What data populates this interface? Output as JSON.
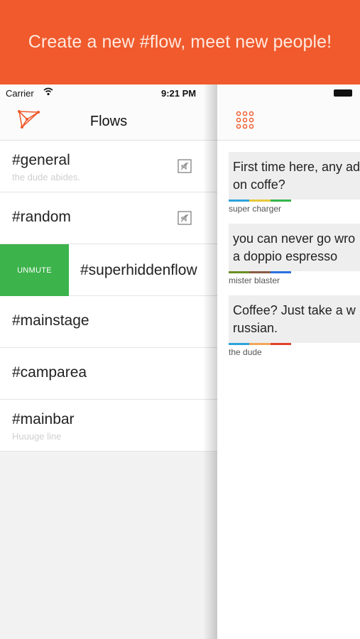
{
  "banner": {
    "text": "Create a new #flow, meet new people!"
  },
  "status_bar": {
    "carrier": "Carrier",
    "time": "9:21 PM"
  },
  "navbar": {
    "title": "Flows"
  },
  "flows": [
    {
      "name": "#general",
      "subtitle": "the dude abides.",
      "muted": true
    },
    {
      "name": "#random",
      "subtitle": "",
      "muted": true
    },
    {
      "name": "#superhiddenflow",
      "subtitle": "",
      "action_label": "UNMUTE"
    },
    {
      "name": "#mainstage",
      "subtitle": ""
    },
    {
      "name": "#camparea",
      "subtitle": ""
    },
    {
      "name": "#mainbar",
      "subtitle": "Huuuge line"
    }
  ],
  "messages": [
    {
      "line1": "First time here, any ad",
      "line2": "on coffe?",
      "author": "super charger",
      "colors": [
        "#2ba3dc",
        "#e6c93a",
        "#37b34a"
      ]
    },
    {
      "line1": "you can never go wro",
      "line2": "a doppio espresso",
      "author": "mister blaster",
      "colors": [
        "#6b8e23",
        "#8a5a44",
        "#2b6fe0"
      ]
    },
    {
      "line1": "Coffee? Just take a w",
      "line2": "russian.",
      "author": "the dude",
      "colors": [
        "#2ba3dc",
        "#f2a65a",
        "#e0412b"
      ]
    }
  ],
  "colors": {
    "accent": "#f05a2c",
    "unmute": "#3cb34b"
  }
}
